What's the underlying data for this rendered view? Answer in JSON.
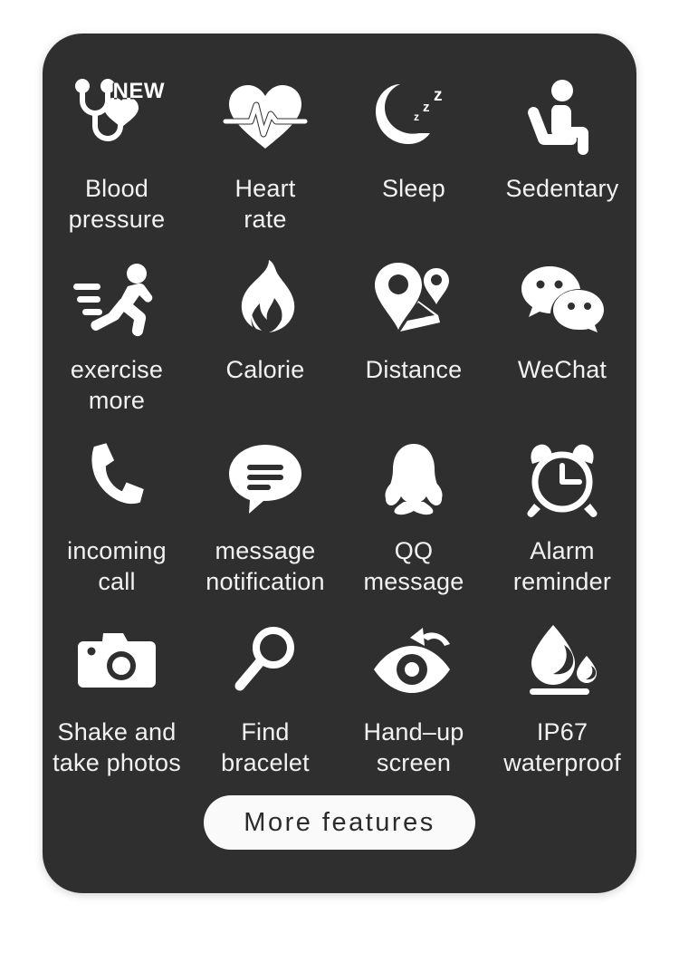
{
  "card": {
    "background_color": "#2f2f2f",
    "text_color": "#f2f2f2",
    "page_background": "#ffffff"
  },
  "features": [
    {
      "icon": "stethoscope-heart-icon",
      "label": "Blood\npressure",
      "badge": "NEW"
    },
    {
      "icon": "heart-rate-icon",
      "label": "Heart\nrate",
      "badge": ""
    },
    {
      "icon": "sleep-moon-icon",
      "label": "Sleep",
      "badge": ""
    },
    {
      "icon": "sedentary-sitting-person-icon",
      "label": "Sedentary",
      "badge": ""
    },
    {
      "icon": "running-person-icon",
      "label": "exercise\nmore",
      "badge": ""
    },
    {
      "icon": "flame-icon",
      "label": "Calorie",
      "badge": ""
    },
    {
      "icon": "map-pin-route-icon",
      "label": "Distance",
      "badge": ""
    },
    {
      "icon": "wechat-bubbles-icon",
      "label": "WeChat",
      "badge": ""
    },
    {
      "icon": "phone-handset-icon",
      "label": "incoming\ncall",
      "badge": ""
    },
    {
      "icon": "message-bubble-icon",
      "label": "message\nnotification",
      "badge": ""
    },
    {
      "icon": "qq-penguin-icon",
      "label": "QQ\nmessage",
      "badge": ""
    },
    {
      "icon": "alarm-clock-icon",
      "label": "Alarm\nreminder",
      "badge": ""
    },
    {
      "icon": "camera-icon",
      "label": "Shake and\ntake photos",
      "badge": ""
    },
    {
      "icon": "magnifier-icon",
      "label": "Find\nbracelet",
      "badge": ""
    },
    {
      "icon": "eye-raise-arrow-icon",
      "label": "Hand–up\nscreen",
      "badge": ""
    },
    {
      "icon": "water-drop-icon",
      "label": "IP67\nwaterproof",
      "badge": ""
    }
  ],
  "footer": {
    "more_button_label": "More features"
  }
}
